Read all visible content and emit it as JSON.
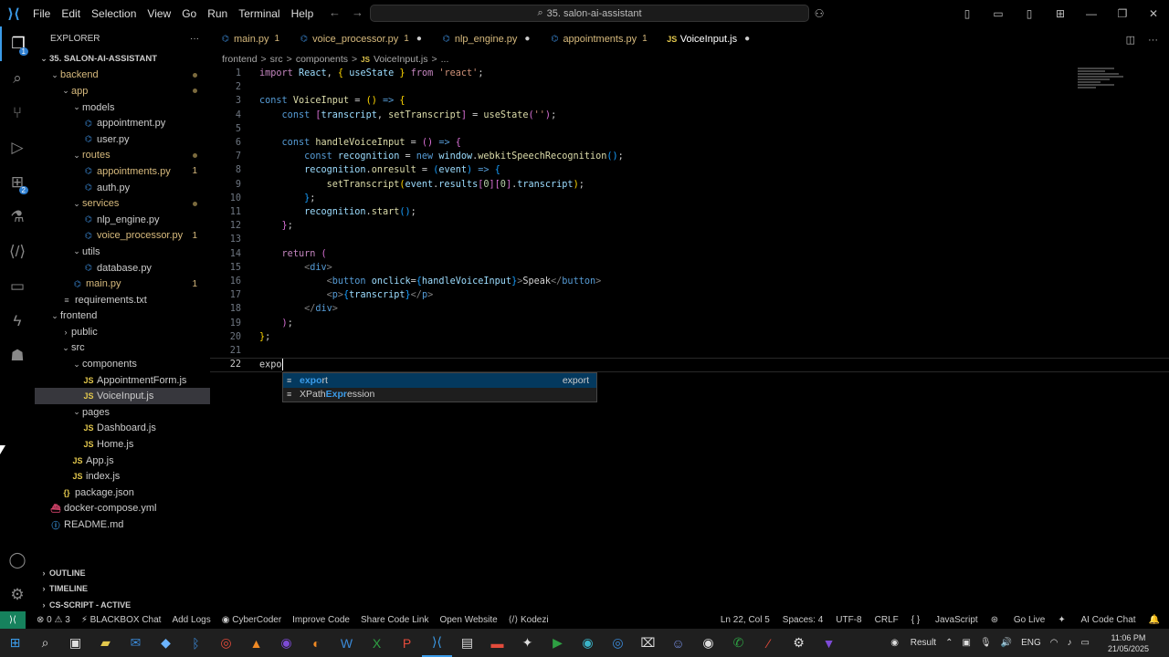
{
  "titlebar": {
    "menu": [
      "File",
      "Edit",
      "Selection",
      "View",
      "Go",
      "Run",
      "Terminal",
      "Help"
    ],
    "search": "35. salon-ai-assistant"
  },
  "explorer": {
    "header": "EXPLORER",
    "root": "35. SALON-AI-ASSISTANT",
    "tree": [
      {
        "label": "backend",
        "depth": 0,
        "kind": "folder",
        "open": true,
        "color": "yellow",
        "dot": true
      },
      {
        "label": "app",
        "depth": 1,
        "kind": "folder",
        "open": true,
        "color": "yellow",
        "dot": true
      },
      {
        "label": "models",
        "depth": 2,
        "kind": "folder",
        "open": true,
        "color": "white"
      },
      {
        "label": "appointment.py",
        "depth": 3,
        "kind": "py",
        "color": "white"
      },
      {
        "label": "user.py",
        "depth": 3,
        "kind": "py",
        "color": "white"
      },
      {
        "label": "routes",
        "depth": 2,
        "kind": "folder",
        "open": true,
        "color": "yellow",
        "dot": true
      },
      {
        "label": "appointments.py",
        "depth": 3,
        "kind": "py",
        "color": "yellow",
        "count": "1"
      },
      {
        "label": "auth.py",
        "depth": 3,
        "kind": "py",
        "color": "white"
      },
      {
        "label": "services",
        "depth": 2,
        "kind": "folder",
        "open": true,
        "color": "yellow",
        "dot": true
      },
      {
        "label": "nlp_engine.py",
        "depth": 3,
        "kind": "py",
        "color": "white"
      },
      {
        "label": "voice_processor.py",
        "depth": 3,
        "kind": "py",
        "color": "yellow",
        "count": "1"
      },
      {
        "label": "utils",
        "depth": 2,
        "kind": "folder",
        "open": true,
        "color": "white"
      },
      {
        "label": "database.py",
        "depth": 3,
        "kind": "py",
        "color": "white"
      },
      {
        "label": "main.py",
        "depth": 2,
        "kind": "py",
        "color": "yellow",
        "count": "1"
      },
      {
        "label": "requirements.txt",
        "depth": 1,
        "kind": "txt",
        "color": "white"
      },
      {
        "label": "frontend",
        "depth": 0,
        "kind": "folder",
        "open": true,
        "color": "white"
      },
      {
        "label": "public",
        "depth": 1,
        "kind": "folder",
        "open": false,
        "color": "white"
      },
      {
        "label": "src",
        "depth": 1,
        "kind": "folder",
        "open": true,
        "color": "white"
      },
      {
        "label": "components",
        "depth": 2,
        "kind": "folder",
        "open": true,
        "color": "white"
      },
      {
        "label": "AppointmentForm.js",
        "depth": 3,
        "kind": "js",
        "color": "white"
      },
      {
        "label": "VoiceInput.js",
        "depth": 3,
        "kind": "js",
        "color": "white",
        "selected": true
      },
      {
        "label": "pages",
        "depth": 2,
        "kind": "folder",
        "open": true,
        "color": "white"
      },
      {
        "label": "Dashboard.js",
        "depth": 3,
        "kind": "js",
        "color": "white"
      },
      {
        "label": "Home.js",
        "depth": 3,
        "kind": "js",
        "color": "white"
      },
      {
        "label": "App.js",
        "depth": 2,
        "kind": "js",
        "color": "white"
      },
      {
        "label": "index.js",
        "depth": 2,
        "kind": "js",
        "color": "white"
      },
      {
        "label": "package.json",
        "depth": 1,
        "kind": "json",
        "color": "white"
      },
      {
        "label": "docker-compose.yml",
        "depth": 0,
        "kind": "yml",
        "color": "white"
      },
      {
        "label": "README.md",
        "depth": 0,
        "kind": "info",
        "color": "white"
      }
    ],
    "sections": [
      "OUTLINE",
      "TIMELINE",
      "CS-SCRIPT - ACTIVE"
    ]
  },
  "tabs": [
    {
      "label": "main.py",
      "mod": "1",
      "kind": "py"
    },
    {
      "label": "voice_processor.py",
      "mod": "1",
      "dirty": true,
      "kind": "py"
    },
    {
      "label": "nlp_engine.py",
      "dirty": true,
      "kind": "py"
    },
    {
      "label": "appointments.py",
      "mod": "1",
      "kind": "py"
    },
    {
      "label": "VoiceInput.js",
      "dirty": true,
      "kind": "js",
      "active": true
    }
  ],
  "breadcrumbs": [
    "frontend",
    ">",
    "src",
    ">",
    "components",
    ">",
    "VoiceInput.js",
    ">",
    "..."
  ],
  "code": {
    "current_line": "22",
    "typed": "expo"
  },
  "suggest": {
    "items": [
      {
        "pre": "",
        "match": "expo",
        "post": "rt",
        "detail": "export",
        "selected": true
      },
      {
        "pre": "XPath",
        "match": "Expr",
        "post": "ession",
        "detail": ""
      }
    ]
  },
  "statusbar": {
    "left": [
      "0",
      "3",
      "BLACKBOX Chat",
      "Add Logs",
      "CyberCoder",
      "Improve Code",
      "Share Code Link",
      "Open Website",
      "Kodezi"
    ],
    "right": [
      "Ln 22, Col 5",
      "Spaces: 4",
      "UTF-8",
      "CRLF",
      "JavaScript",
      "Go Live",
      "AI Code Chat"
    ]
  },
  "taskbar": {
    "result": "Result",
    "lang": "ENG",
    "time": "11:06 PM",
    "date": "21/05/2025"
  }
}
